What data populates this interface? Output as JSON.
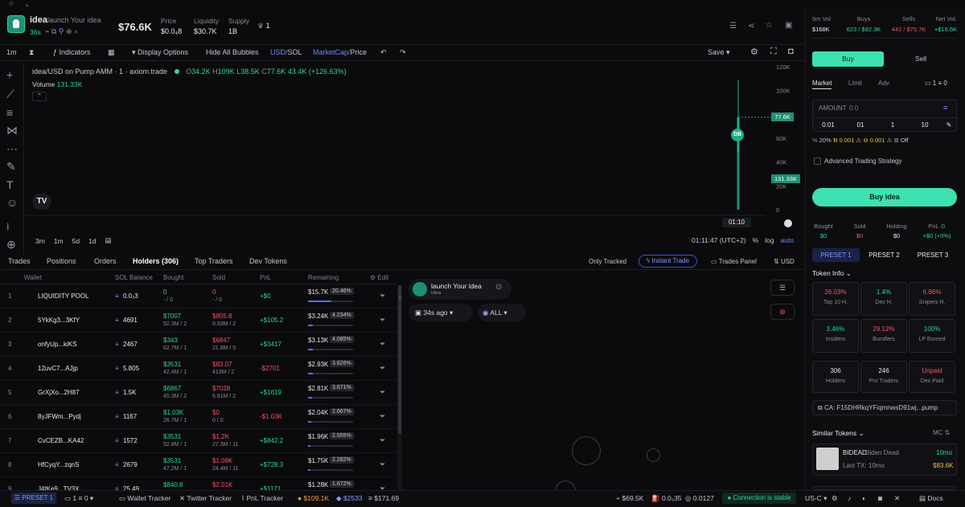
{
  "token": {
    "symbol": "idea",
    "name": "launch Your idea",
    "age": "36s",
    "price_mc": "$76.6K",
    "price_label": "Price",
    "price": "$0.0₄8",
    "liquidity_label": "Liquidity",
    "liquidity": "$30.7K",
    "supply_label": "Supply",
    "supply": "1B",
    "holders_icon_count": "1"
  },
  "toolbar": {
    "interval": "1m",
    "indicators": "Indicators",
    "display_options": "Display Options",
    "hide_bubbles": "Hide All Bubbles",
    "usd": "USD",
    "sep": "/",
    "sol": "SOL",
    "marketcap": "MarketCap",
    "price": "Price",
    "save": "Save"
  },
  "chart": {
    "title": "idea/USD on Pump AMM · 1 · axiom.trade",
    "o": "34.2K",
    "h": "109K",
    "l": "38.5K",
    "c": "77.6K",
    "chg": "43.4K (+126.63%)",
    "volume_label": "Volume",
    "volume": "131.33K",
    "price_tag": "77.6K",
    "vol_tag": "131.33K",
    "marker": "DB",
    "time_label": "01:10",
    "ranges": [
      "3m",
      "1m",
      "5d",
      "1d"
    ],
    "clock": "01:11:47 (UTC+2)",
    "pct": "%",
    "log": "log",
    "auto": "auto",
    "o_l": "O",
    "h_l": "H",
    "l_l": "L",
    "c_l": "C"
  },
  "chart_data": {
    "type": "bar",
    "categories": [
      "01:10"
    ],
    "ylim": [
      0,
      120000
    ],
    "ticks": [
      "120K",
      "100K",
      "80K",
      "60K",
      "40K",
      "20K",
      "0"
    ],
    "series": [
      {
        "name": "",
        "values": [
          77600
        ]
      }
    ],
    "ohlc": {
      "o": 34200,
      "h": 109000,
      "l": 38500,
      "c": 77600
    },
    "volume": 131330
  },
  "tabs": [
    "Trades",
    "Positions",
    "Orders",
    "Holders (306)",
    "Top Traders",
    "Dev Tokens"
  ],
  "tab_opts": {
    "only_tracked": "Only Tracked",
    "instant_trade": "Instant Trade",
    "trades_panel": "Trades Panel",
    "usd": "USD"
  },
  "table": {
    "headers": [
      "Wallet",
      "SOL Balance",
      "Bought",
      "Sold",
      "PnL",
      "Remaining",
      "Edit"
    ],
    "rows": [
      {
        "n": "1",
        "wallet": "LIQUIDITY POOL",
        "sol": "0.0₂3",
        "bought": "0",
        "bsub": "- / 0",
        "sold": "0",
        "ssub": "- / 0",
        "pnl": "+$0",
        "rem": "$15.7K",
        "pct": "20.46%",
        "fill": 0.2046
      },
      {
        "n": "2",
        "wallet": "5YkKg3...3KfY",
        "sol": "4691",
        "bought": "$7007",
        "bsub": "52.3M / 2",
        "sold": "$805.8",
        "ssub": "9.93M / 2",
        "pnl": "+$105.2",
        "rem": "$3.24K",
        "pct": "4.234%",
        "fill": 0.04234
      },
      {
        "n": "3",
        "wallet": "onfyUp...kiKS",
        "sol": "2467",
        "bought": "$343",
        "bsub": "62.7M / 1",
        "sold": "$6847",
        "ssub": "21.8M / 5",
        "pnl": "+$3417",
        "rem": "$3.13K",
        "pct": "4.085%",
        "fill": 0.04085
      },
      {
        "n": "4",
        "wallet": "12uvC7...AJjp",
        "sol": "5.805",
        "bought": "$3531",
        "bsub": "42.4M / 1",
        "sold": "$83.07",
        "ssub": "413M / 2",
        "pnl": "-$2701",
        "rem": "$2.93K",
        "pct": "3.826%",
        "fill": 0.03826
      },
      {
        "n": "5",
        "wallet": "GrXjXo...2H87",
        "sol": "1.5K",
        "bought": "$6867",
        "bsub": "45.3M / 2",
        "sold": "$7028",
        "ssub": "6.61M / 2",
        "pnl": "+$1619",
        "rem": "$2.81K",
        "pct": "3.671%",
        "fill": 0.03671
      },
      {
        "n": "6",
        "wallet": "8yJFWm...Pydj",
        "sol": "1167",
        "bought": "$1.03K",
        "bsub": "26.7M / 1",
        "sold": "$0",
        "ssub": "0 / 0",
        "pnl": "-$1.03K",
        "rem": "$2.04K",
        "pct": "2.667%",
        "fill": 0.02667
      },
      {
        "n": "7",
        "wallet": "CvCEZB...KA42",
        "sol": "1572",
        "bought": "$3531",
        "bsub": "52.8M / 1",
        "sold": "$1.2K",
        "ssub": "27.3M / 11",
        "pnl": "+$842.2",
        "rem": "$1.96K",
        "pct": "2.555%",
        "fill": 0.02555
      },
      {
        "n": "8",
        "wallet": "HfCyqY...zqnS",
        "sol": "2679",
        "bought": "$3531",
        "bsub": "47.2M / 1",
        "sold": "$1.08K",
        "ssub": "24.4M / 11",
        "pnl": "+$728.3",
        "rem": "$1.75K",
        "pct": "2.282%",
        "fill": 0.02282
      },
      {
        "n": "9",
        "wallet": "J4tKe9...TV3X",
        "sol": "25.49",
        "bought": "$840.8",
        "bsub": "",
        "sold": "$2.01K",
        "ssub": "",
        "pnl": "+$1171",
        "rem": "$1.28K",
        "pct": "1.672%",
        "fill": 0.01672
      }
    ]
  },
  "feed": {
    "name": "launch Your idea",
    "sym": "idea",
    "ago": "34s ago",
    "all": "ALL"
  },
  "right": {
    "vol_label": "5m Vol",
    "vol": "$168K",
    "buys_label": "Buys",
    "buys": "623 / $92.3K",
    "sells_label": "Sells",
    "sells": "442 / $75.7K",
    "net_label": "Net Vol.",
    "net": "+$16.6K",
    "buy_tab": "Buy",
    "sell_tab": "Sell",
    "market": "Market",
    "limit": "Limit",
    "adv": "Adv.",
    "slot": "1",
    "zero": "0",
    "amount": "AMOUNT",
    "amount_ph": "0.0",
    "q": [
      "0.01",
      "01",
      "1",
      "10"
    ],
    "slip": "20%",
    "prio": "0.001",
    "bribe": "0.001",
    "off": "Off",
    "ats": "Advanced Trading Strategy",
    "buy_btn": "Buy idea",
    "bought_l": "Bought",
    "bought": "$0",
    "sold_l": "Sold",
    "sold": "$0",
    "holding_l": "Holding",
    "holding": "$0",
    "pnl_l": "PnL",
    "pnl": "+$0 (+0%)",
    "presets": [
      "PRESET 1",
      "PRESET 2",
      "PRESET 3"
    ],
    "token_info": "Token Info",
    "metrics": [
      {
        "v": "26.03%",
        "l": "Top 10 H.",
        "c": "r"
      },
      {
        "v": "1.4%",
        "l": "Dev H.",
        "c": "g"
      },
      {
        "v": "6.86%",
        "l": "Snipers H.",
        "c": "r"
      },
      {
        "v": "3.46%",
        "l": "Insiders",
        "c": "g"
      },
      {
        "v": "29.12%",
        "l": "Bundlers",
        "c": "r"
      },
      {
        "v": "100%",
        "l": "LP Burned",
        "c": "g"
      },
      {
        "v": "306",
        "l": "Holders",
        "c": "w"
      },
      {
        "v": "246",
        "l": "Pro Traders",
        "c": "w"
      },
      {
        "v": "Unpaid",
        "l": "Dex Paid",
        "c": "r"
      }
    ],
    "ca": "CA: F15DHRkqYFiqmnwsD91wj...pump",
    "similar": "Similar Tokens",
    "mc": "MC",
    "sim_name": "BIDEAD",
    "sim_desc": "Biden Dead",
    "sim_time": "10mo",
    "sim_last": "Last TX: 10mo",
    "sim_mc": "$83.6K"
  },
  "status": {
    "preset": "PRESET 1",
    "slot": "1",
    "zero": "0",
    "wallet_tracker": "Wallet Tracker",
    "twitter_tracker": "Twitter Tracker",
    "pnl_tracker": "PnL Tracker",
    "btc": "$109.1K",
    "eth": "$2533",
    "sol": "$171.69",
    "mc": "$69.5K",
    "f1": "0.0₂35",
    "f2": "0.0127",
    "conn": "Connection is stable",
    "region": "US-C",
    "docs": "Docs"
  }
}
